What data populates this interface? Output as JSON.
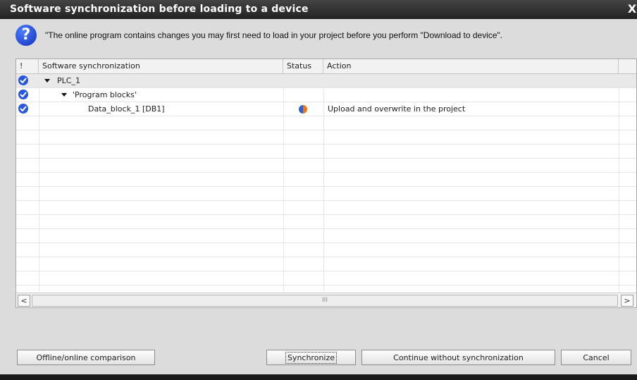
{
  "dialog": {
    "title": "Software synchronization before loading to a device",
    "message": "\"The online program contains changes you may first need to load in your project before you perform \"Download to device\"."
  },
  "table": {
    "columns": [
      "!",
      "Software synchronization",
      "Status",
      "Action"
    ],
    "rows": [
      {
        "name": "PLC_1",
        "status": "",
        "action": "",
        "checked": true,
        "expanded": true
      },
      {
        "name": "'Program blocks'",
        "status": "",
        "action": "",
        "checked": true,
        "expanded": true
      },
      {
        "name": "Data_block_1 [DB1]",
        "status": "status-icon-half-blue-orange",
        "action": "Upload and overwrite in the project",
        "checked": true,
        "expanded": false
      }
    ]
  },
  "scrollbar": {
    "left": "<",
    "right": ">",
    "thumb": "III"
  },
  "buttons": {
    "comparison": "Offline/online comparison",
    "synchronize": "Synchronize",
    "continue": "Continue without synchronization",
    "cancel": "Cancel"
  },
  "icons": {
    "close": "X",
    "message": "?"
  },
  "colors": {
    "accent": "#2856e0",
    "title_bar": "#2a2a2a",
    "status_blue": "#2a5fd8",
    "status_orange": "#e8781a"
  }
}
